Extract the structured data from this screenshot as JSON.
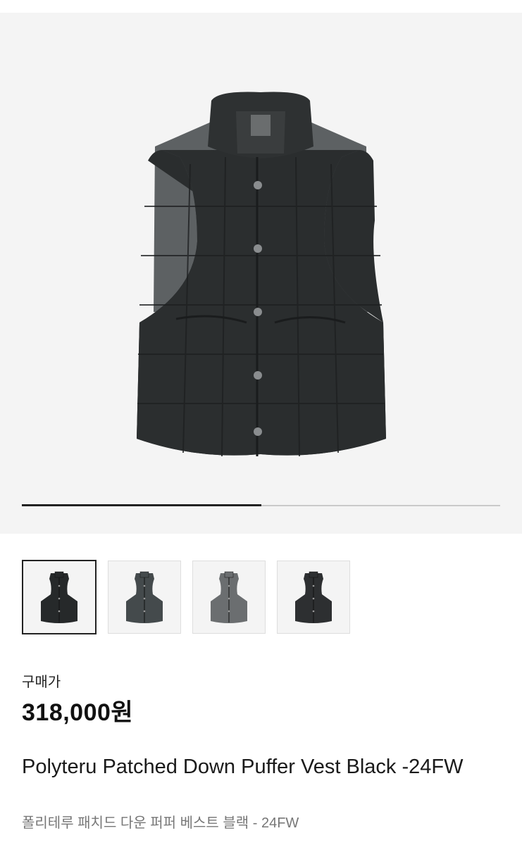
{
  "product": {
    "price_label": "구매가",
    "price": "318,000원",
    "title": "Polyteru Patched Down Puffer Vest Black -24FW",
    "subtitle": "폴리테루 패치드 다운 퍼퍼 베스트 블랙 - 24FW"
  },
  "gallery": {
    "progress_fraction": 0.5,
    "thumbnails": [
      {
        "name": "thumb-vest-black",
        "color": "#26292a",
        "selected": true
      },
      {
        "name": "thumb-vest-charcoal",
        "color": "#444a4c",
        "selected": false
      },
      {
        "name": "thumb-vest-grey",
        "color": "#6b6e70",
        "selected": false
      },
      {
        "name": "thumb-vest-dark",
        "color": "#2d2f31",
        "selected": false
      }
    ]
  },
  "colors": {
    "hero_bg": "#f4f4f4",
    "vest": "#2a2d2e",
    "accent": "#222222"
  }
}
